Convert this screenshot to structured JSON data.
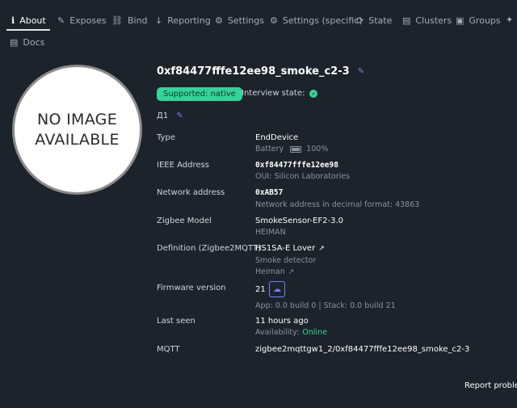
{
  "tabs": [
    {
      "label": "About",
      "icon": "info-icon"
    },
    {
      "label": "Exposes",
      "icon": "pencil-icon"
    },
    {
      "label": "Bind",
      "icon": "link-icon"
    },
    {
      "label": "Reporting",
      "icon": "arrow-down-icon"
    },
    {
      "label": "Settings",
      "icon": "gears-icon"
    },
    {
      "label": "Settings (specific)",
      "icon": "gear-icon"
    },
    {
      "label": "State",
      "icon": "refresh-icon"
    },
    {
      "label": "Clusters",
      "icon": "document-icon"
    },
    {
      "label": "Groups",
      "icon": "groups-icon"
    },
    {
      "label": "Docs",
      "icon": "file-icon"
    }
  ],
  "device": {
    "image_placeholder": "NO IMAGE AVAILABLE",
    "name": "0xf84477fffe12ee98_smoke_c2-3",
    "support_badge": "Supported: native",
    "interview_label": "Interview state:",
    "description": "Д1"
  },
  "details": {
    "type_label": "Type",
    "type_value": "EndDevice",
    "power_label": "Battery",
    "battery_value": "100%",
    "ieee_label": "IEEE Address",
    "ieee_value": "0xf84477fffe12ee98",
    "oui": "OUI: Silicon Laboratories",
    "network_label": "Network address",
    "network_value": "0xAB57",
    "network_decimal": "Network address in decimal format: 43863",
    "model_label": "Zigbee Model",
    "model_value": "SmokeSensor-EF2-3.0",
    "manufacturer": "HEIMAN",
    "definition_label": "Definition (Zigbee2MQTT)",
    "definition_value": "HS1SA-E Lover",
    "definition_desc": "Smoke detector",
    "vendor": "Heiman",
    "firmware_label": "Firmware version",
    "firmware_value": "21",
    "firmware_build": "App: 0.0 build 0 | Stack: 0.0 build 21",
    "last_seen_label": "Last seen",
    "last_seen_value": "11 hours ago",
    "availability_label": "Availability:",
    "availability_value": "Online",
    "mqtt_label": "MQTT",
    "mqtt_value": "zigbee2mqttgw1_2/0xf84477fffe12ee98_smoke_c2-3"
  },
  "footer": {
    "report": "Report problem"
  },
  "colors": {
    "accent": "#7480ff",
    "success": "#36d399",
    "background": "#1d232a"
  }
}
